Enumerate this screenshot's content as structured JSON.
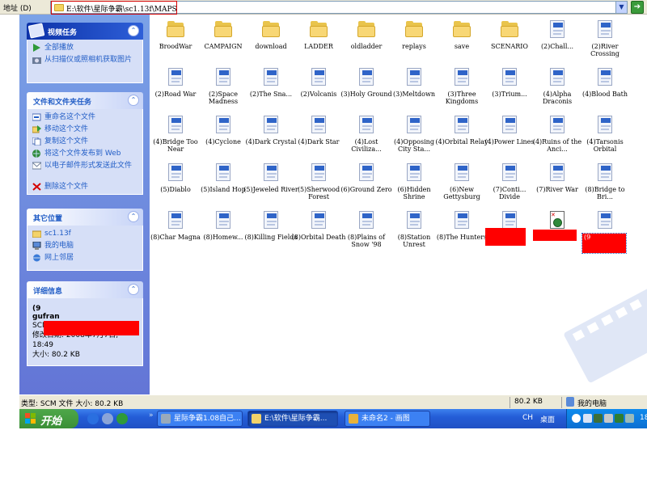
{
  "address_bar": {
    "label": "地址 (D)",
    "path": "E:\\软件\\星际争霸\\sc1.13f\\MAPS",
    "go_label": "转到"
  },
  "left_pane": {
    "video_tasks": {
      "title": "视频任务",
      "items": [
        "全部播放",
        "从扫描仪或照相机获取图片"
      ]
    },
    "file_tasks": {
      "title": "文件和文件夹任务",
      "items": [
        "重命名这个文件",
        "移动这个文件",
        "复制这个文件",
        "将这个文件发布到 Web",
        "以电子邮件形式发送此文件",
        "删除这个文件"
      ]
    },
    "other_places": {
      "title": "其它位置",
      "items": [
        "sc1.13f",
        "我的电脑",
        "网上邻居"
      ]
    },
    "details": {
      "title": "详细信息",
      "name_prefix": "(9",
      "name_suffix": "gufran",
      "type": "SCM 文件",
      "modified": "修改日期: 2008年7月7日, 18:49",
      "size": "大小: 80.2 KB"
    }
  },
  "files": [
    {
      "kind": "folder",
      "label": "BroodWar"
    },
    {
      "kind": "folder",
      "label": "CAMPAIGN"
    },
    {
      "kind": "folder",
      "label": "download"
    },
    {
      "kind": "folder",
      "label": "LADDER"
    },
    {
      "kind": "folder",
      "label": "oldladder"
    },
    {
      "kind": "folder",
      "label": "replays"
    },
    {
      "kind": "folder",
      "label": "save"
    },
    {
      "kind": "folder",
      "label": "SCENARIO"
    },
    {
      "kind": "real",
      "label": "(2)Chall..."
    },
    {
      "kind": "real",
      "label": "(2)River Crossing"
    },
    {
      "kind": "real",
      "label": "(2)Road War"
    },
    {
      "kind": "real",
      "label": "(2)Space Madness"
    },
    {
      "kind": "real",
      "label": "(2)The Sna..."
    },
    {
      "kind": "real",
      "label": "(2)Volcanis"
    },
    {
      "kind": "real",
      "label": "(3)Holy Ground"
    },
    {
      "kind": "real",
      "label": "(3)Meltdown"
    },
    {
      "kind": "real",
      "label": "(3)Three Kingdoms"
    },
    {
      "kind": "real",
      "label": "(3)Trium..."
    },
    {
      "kind": "real",
      "label": "(4)Alpha Draconis"
    },
    {
      "kind": "real",
      "label": "(4)Blood Bath"
    },
    {
      "kind": "real",
      "label": "(4)Bridge Too Near"
    },
    {
      "kind": "real",
      "label": "(4)Cyclone"
    },
    {
      "kind": "real",
      "label": "(4)Dark Crystal"
    },
    {
      "kind": "real",
      "label": "(4)Dark Star"
    },
    {
      "kind": "real",
      "label": "(4)Lost Civiliza..."
    },
    {
      "kind": "real",
      "label": "(4)Opposing City Sta..."
    },
    {
      "kind": "real",
      "label": "(4)Orbital Relay"
    },
    {
      "kind": "real",
      "label": "(4)Power Lines"
    },
    {
      "kind": "real",
      "label": "(4)Ruins of the Anci..."
    },
    {
      "kind": "real",
      "label": "(4)Tarsonis Orbital"
    },
    {
      "kind": "real",
      "label": "(5)Diablo"
    },
    {
      "kind": "real",
      "label": "(5)Island Hop"
    },
    {
      "kind": "real",
      "label": "(5)Jeweled River"
    },
    {
      "kind": "real",
      "label": "(5)Sherwood Forest"
    },
    {
      "kind": "real",
      "label": "(6)Ground Zero"
    },
    {
      "kind": "real",
      "label": "(6)Hidden Shrine"
    },
    {
      "kind": "real",
      "label": "(6)New Gettysburg"
    },
    {
      "kind": "real",
      "label": "(7)Conti... Divide"
    },
    {
      "kind": "real",
      "label": "(7)River War"
    },
    {
      "kind": "real",
      "label": "(8)Bridge to Bri..."
    },
    {
      "kind": "real",
      "label": "(8)Char Magna"
    },
    {
      "kind": "real",
      "label": "(8)Homew..."
    },
    {
      "kind": "real",
      "label": "(8)Killing Fields"
    },
    {
      "kind": "real",
      "label": "(8)Orbital Death"
    },
    {
      "kind": "real",
      "label": "(8)Plains of Snow '98"
    },
    {
      "kind": "real",
      "label": "(8)Station Unrest"
    },
    {
      "kind": "real",
      "label": "(8)The Hunters"
    },
    {
      "kind": "redacted",
      "label": ""
    },
    {
      "kind": "doc",
      "label": ""
    },
    {
      "kind": "selected",
      "label": "(9"
    }
  ],
  "status_bar": {
    "left": "类型: SCM 文件 大小: 80.2 KB",
    "size": "80.2 KB",
    "location": "我的电脑"
  },
  "taskbar": {
    "start_label": "开始",
    "windows": [
      "星际争霸1.08自己...",
      "E:\\软件\\星际争霸...",
      "未命名2 - 画图"
    ],
    "language": "CH",
    "desktop": "桌面",
    "clock": "18"
  },
  "colors": {
    "accent_blue": "#215dc6",
    "taskbar_blue": "#245dd7",
    "start_green": "#3b8f36",
    "redaction": "#ff0000"
  }
}
